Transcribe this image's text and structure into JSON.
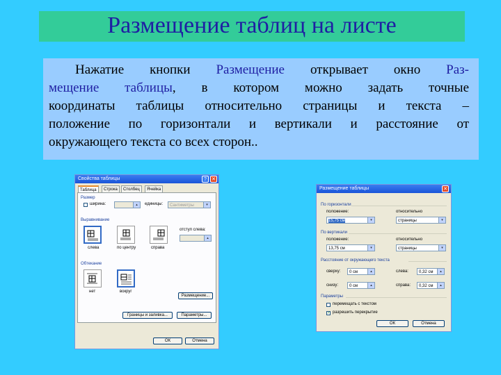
{
  "slide": {
    "title": "Размещение таблиц на листе",
    "paragraph": {
      "line1_a": "Нажатие кнопки ",
      "line1_link": "Размещение",
      "line1_b": " открывает окно ",
      "line1_link2": "Раз-",
      "line2_link": "мещение таблицы",
      "line2_b": ", в котором можно задать точные",
      "line3": "координаты таблицы относительно страницы и текста –",
      "line4": "положение по горизонтали и вертикали и расстояние от",
      "line5": "окружающего текста со всех сторон.."
    }
  },
  "table_properties_dialog": {
    "title": "Свойства таблицы",
    "help_glyph": "?",
    "close_glyph": "✕",
    "tabs": [
      "Таблица",
      "Строка",
      "Столбец",
      "Ячейка"
    ],
    "size_group": "Размер",
    "width_label": "ширина:",
    "units_label": "единицы:",
    "units_value": "Сантиметры",
    "align_group": "Выравнивание",
    "align_options": [
      "слева",
      "по центру",
      "справа"
    ],
    "indent_label": "отступ слева:",
    "wrap_group": "Обтекание",
    "wrap_options": [
      "нет",
      "вокруг"
    ],
    "placement_button": "Размещение...",
    "borders_button": "Границы и заливка...",
    "params_button": "Параметры...",
    "ok_button": "ОК",
    "cancel_button": "Отмена"
  },
  "table_positioning_dialog": {
    "title": "Размещение таблицы",
    "close_glyph": "✕",
    "horizontal_group": "По горизонтали",
    "h_position_label": "положение:",
    "h_position_value": "15,75 см",
    "h_relative_label": "относительно",
    "h_relative_value": "страницы",
    "vertical_group": "По вертикали",
    "v_position_label": "положение:",
    "v_position_value": "13,75 см",
    "v_relative_label": "относительно",
    "v_relative_value": "страницы",
    "distance_group": "Расстояние от окружающего текста",
    "top_label": "сверху:",
    "top_value": "0 см",
    "left_label": "слева:",
    "left_value": "0,32 см",
    "bottom_label": "снизу:",
    "bottom_value": "0 см",
    "right_label": "справа:",
    "right_value": "0,32 см",
    "params_group": "Параметры",
    "move_with_text": "перемещать с текстом",
    "allow_overlap": "разрешить перекрытие",
    "check_glyph": "✓",
    "ok_button": "ОК",
    "cancel_button": "Отмена"
  },
  "colors": {
    "background": "#33ccff",
    "title_bar": "#33cc99",
    "title_text": "#1f1fa3",
    "text_box": "#99ccff",
    "highlight_text": "#1f1fa3"
  }
}
